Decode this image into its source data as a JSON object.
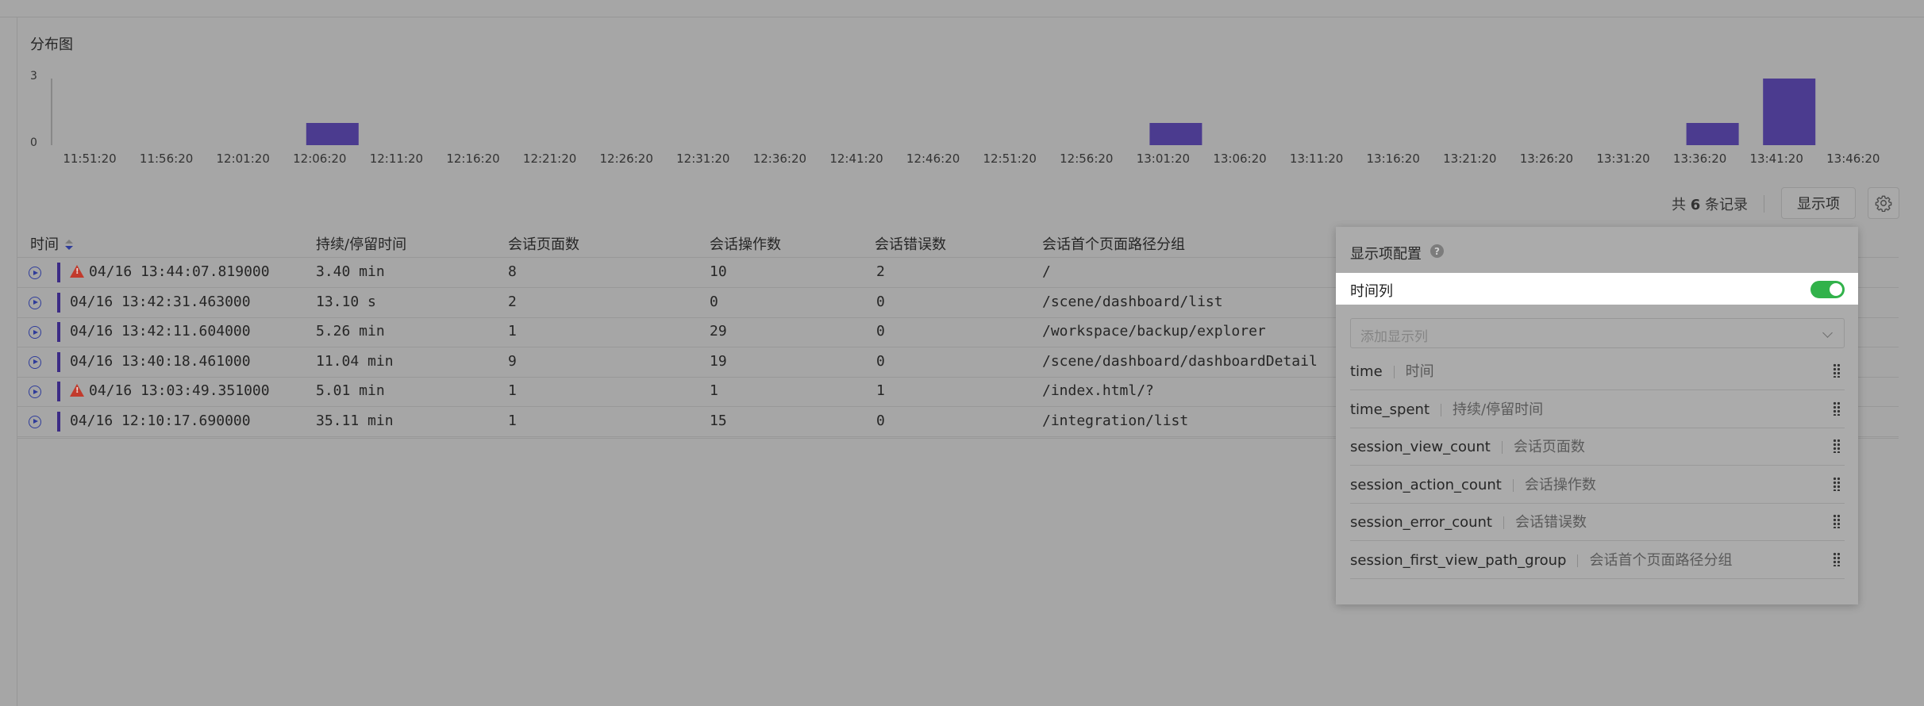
{
  "chart_section": {
    "title": "分布图"
  },
  "chart_data": {
    "type": "bar",
    "categories": [
      "11:51:20",
      "11:56:20",
      "12:01:20",
      "12:06:20",
      "12:11:20",
      "12:16:20",
      "12:21:20",
      "12:26:20",
      "12:31:20",
      "12:36:20",
      "12:41:20",
      "12:46:20",
      "12:51:20",
      "12:56:20",
      "13:01:20",
      "13:06:20",
      "13:11:20",
      "13:16:20",
      "13:21:20",
      "13:26:20",
      "13:31:20",
      "13:36:20",
      "13:41:20",
      "13:46:20"
    ],
    "values": [
      0,
      0,
      0,
      1,
      0,
      0,
      0,
      0,
      0,
      0,
      0,
      0,
      0,
      0,
      1,
      0,
      0,
      0,
      0,
      0,
      0,
      1,
      3,
      0
    ],
    "title": "",
    "xlabel": "",
    "ylabel": "",
    "yticks": [
      "3",
      "0"
    ],
    "ylim": [
      0,
      3
    ],
    "grid": false,
    "bar_color": "#4b3b8f"
  },
  "toolbar": {
    "count_prefix": "共",
    "count_value": "6",
    "count_suffix": "条记录",
    "display_button": "显示项",
    "settings_icon": "gear-icon"
  },
  "table": {
    "headers": [
      "时间",
      "持续/停留时间",
      "会话页面数",
      "会话操作数",
      "会话错误数",
      "会话首个页面路径分组"
    ],
    "rows": [
      {
        "time": "04/16 13:44:07.819000",
        "duration": "3.40 min",
        "views": "8",
        "actions": "10",
        "errors": "2",
        "path": "/",
        "error_flag": true
      },
      {
        "time": "04/16 13:42:31.463000",
        "duration": "13.10 s",
        "views": "2",
        "actions": "0",
        "errors": "0",
        "path": "/scene/dashboard/list",
        "error_flag": false
      },
      {
        "time": "04/16 13:42:11.604000",
        "duration": "5.26 min",
        "views": "1",
        "actions": "29",
        "errors": "0",
        "path": "/workspace/backup/explorer",
        "error_flag": false
      },
      {
        "time": "04/16 13:40:18.461000",
        "duration": "11.04 min",
        "views": "9",
        "actions": "19",
        "errors": "0",
        "path": "/scene/dashboard/dashboardDetail",
        "error_flag": false
      },
      {
        "time": "04/16 13:03:49.351000",
        "duration": "5.01 min",
        "views": "1",
        "actions": "1",
        "errors": "1",
        "path": "/index.html/?",
        "error_flag": true
      },
      {
        "time": "04/16 12:10:17.690000",
        "duration": "35.11 min",
        "views": "1",
        "actions": "15",
        "errors": "0",
        "path": "/integration/list",
        "error_flag": false
      }
    ],
    "accent_color": "#3c2b86",
    "warning_color": "#c23a2c"
  },
  "popover": {
    "title": "显示项配置",
    "help_icon": "help-icon",
    "toggle_label": "时间列",
    "toggle_on": true,
    "select_placeholder": "添加显示列",
    "columns": [
      {
        "key": "time",
        "alias": "时间"
      },
      {
        "key": "time_spent",
        "alias": "持续/停留时间"
      },
      {
        "key": "session_view_count",
        "alias": "会话页面数"
      },
      {
        "key": "session_action_count",
        "alias": "会话操作数"
      },
      {
        "key": "session_error_count",
        "alias": "会话错误数"
      },
      {
        "key": "session_first_view_path_group",
        "alias": "会话首个页面路径分组"
      }
    ],
    "toggle_color": "#31b24a"
  }
}
